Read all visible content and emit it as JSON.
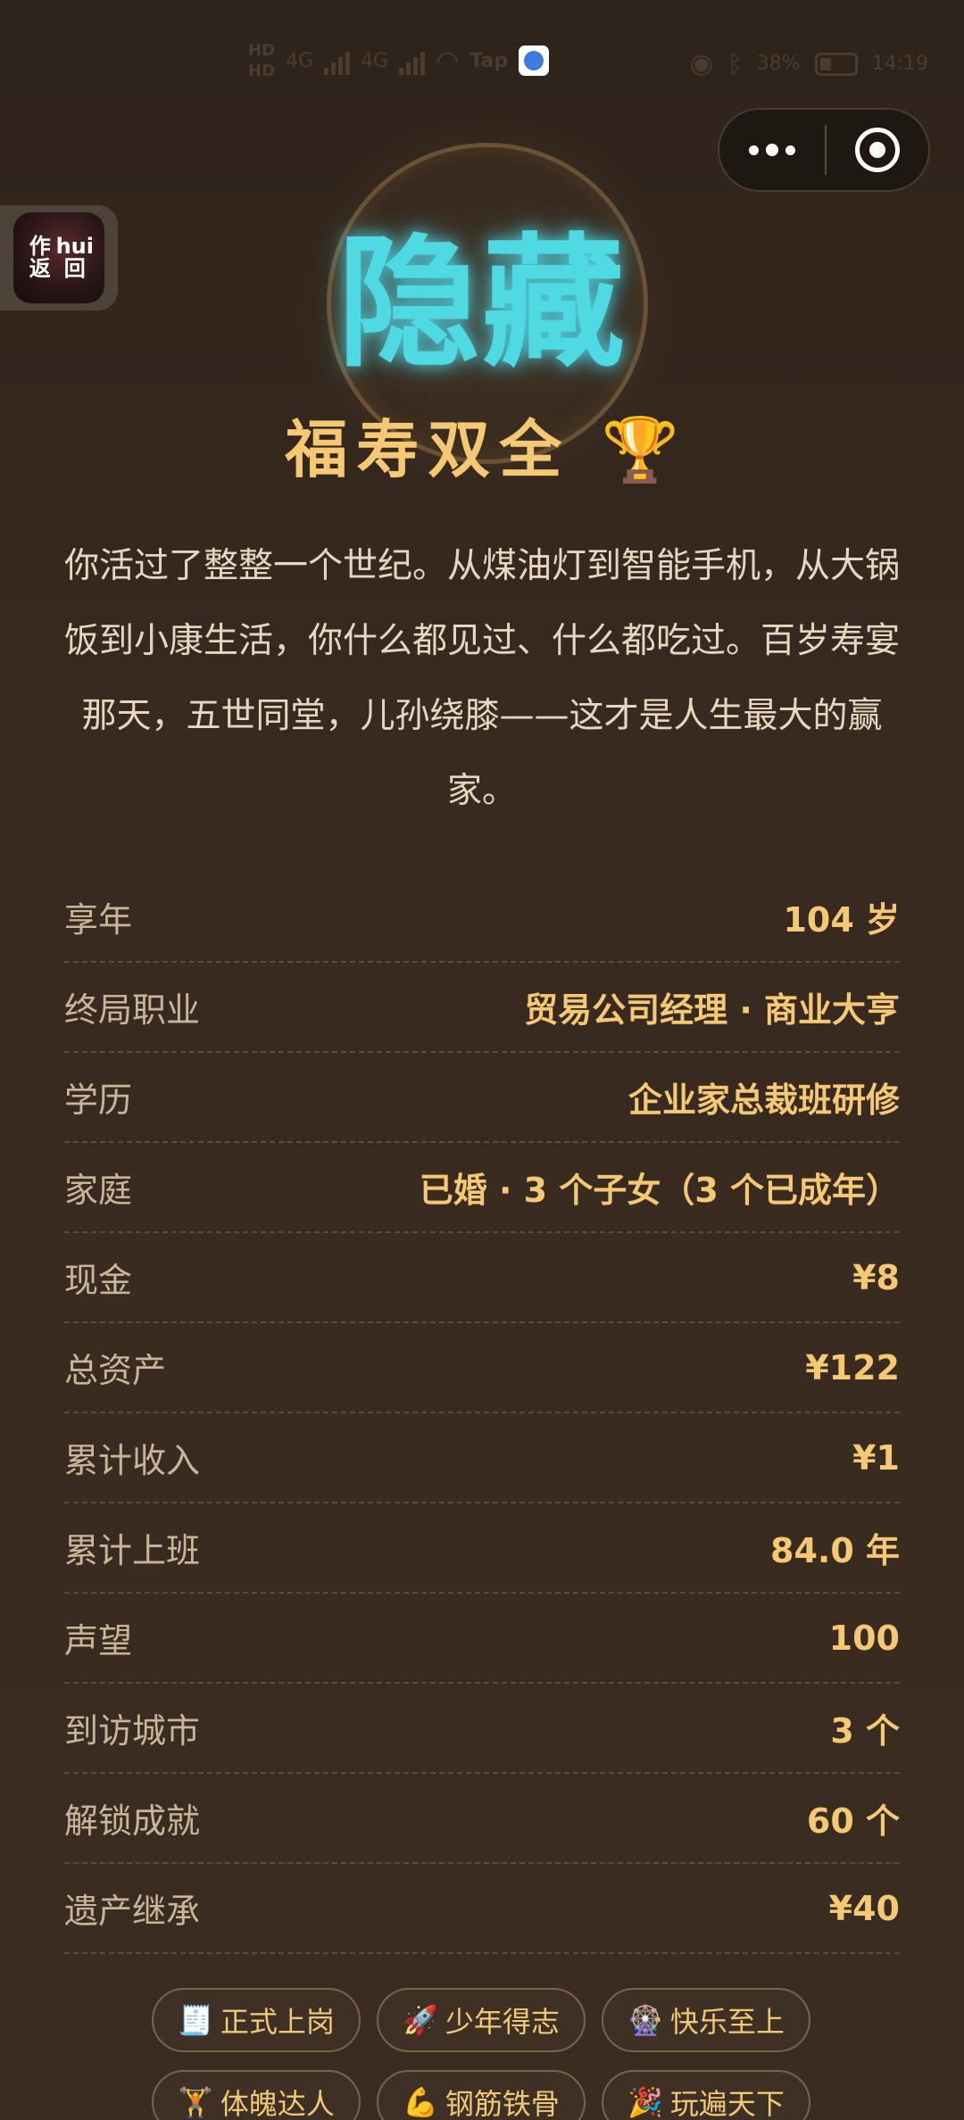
{
  "status_bar": {
    "hd_top": "HD",
    "hd_bottom": "HD",
    "net1": "4G",
    "net2": "4G",
    "tap": "Tap",
    "battery_percent": "38%",
    "time": "14:19"
  },
  "back": {
    "line1_left": "作",
    "line1_right": "hui",
    "line2_left": "返",
    "line2_right": "回"
  },
  "badge": {
    "text": "隐藏"
  },
  "ending": {
    "title": "福寿双全",
    "trophy": "🏆"
  },
  "description": "你活过了整整一个世纪。从煤油灯到智能手机，从大锅饭到小康生活，你什么都见过、什么都吃过。百岁寿宴那天，五世同堂，儿孙绕膝——这才是人生最大的赢家。",
  "stats": [
    {
      "label": "享年",
      "value": "104 岁"
    },
    {
      "label": "终局职业",
      "value": "贸易公司经理 · 商业大亨"
    },
    {
      "label": "学历",
      "value": "企业家总裁班研修"
    },
    {
      "label": "家庭",
      "value": "已婚 · 3 个子女（3 个已成年）"
    },
    {
      "label": "现金",
      "value": "¥8"
    },
    {
      "label": "总资产",
      "value": "¥122"
    },
    {
      "label": "累计收入",
      "value": "¥1"
    },
    {
      "label": "累计上班",
      "value": "84.0 年"
    },
    {
      "label": "声望",
      "value": "100"
    },
    {
      "label": "到访城市",
      "value": "3 个"
    },
    {
      "label": "解锁成就",
      "value": "60 个"
    },
    {
      "label": "遗产继承",
      "value": "¥40"
    }
  ],
  "tags": [
    {
      "icon": "🧾",
      "label": "正式上岗"
    },
    {
      "icon": "🚀",
      "label": "少年得志"
    },
    {
      "icon": "🎡",
      "label": "快乐至上"
    },
    {
      "icon": "🏋",
      "label": "体魄达人"
    },
    {
      "icon": "💪",
      "label": "钢筋铁骨"
    },
    {
      "icon": "🎉",
      "label": "玩遍天下"
    }
  ],
  "colors": {
    "background": "#382a20",
    "accent_gold": "#f5c873",
    "badge_cyan": "#4fd9e3",
    "label_text": "#c9b69a"
  }
}
